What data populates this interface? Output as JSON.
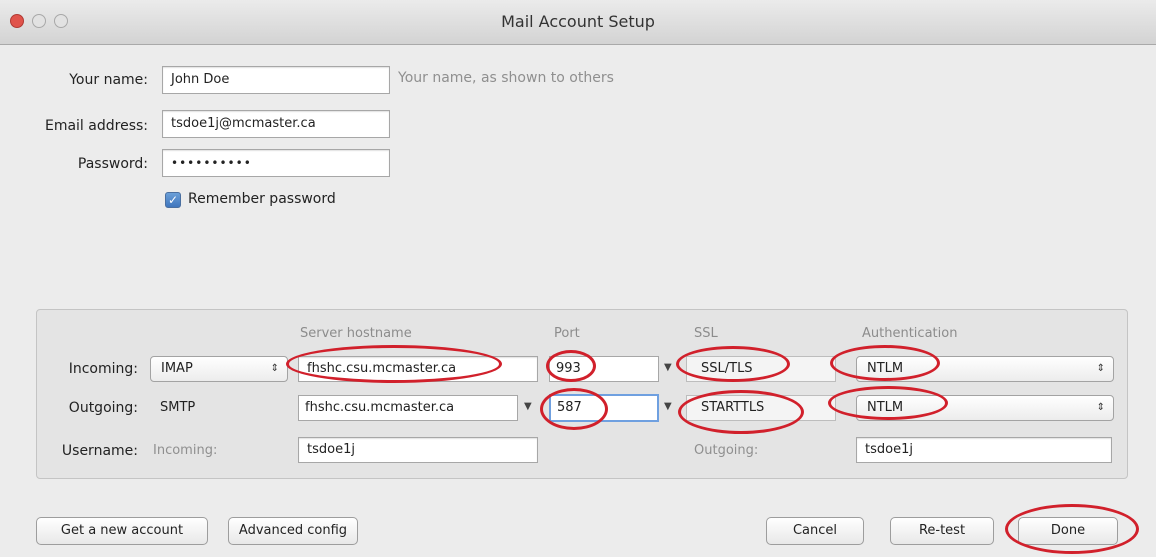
{
  "window": {
    "title": "Mail Account Setup"
  },
  "identity": {
    "name_label": "Your name:",
    "name_value": "John Doe",
    "name_hint": "Your name, as shown to others",
    "email_label": "Email address:",
    "email_value": "tsdoe1j@mcmaster.ca",
    "password_label": "Password:",
    "password_value": "••••••••••",
    "remember_label": "Remember password",
    "remember_checked": true
  },
  "server": {
    "headers": {
      "hostname": "Server hostname",
      "port": "Port",
      "ssl": "SSL",
      "auth": "Authentication"
    },
    "incoming": {
      "label": "Incoming:",
      "protocol": "IMAP",
      "hostname": "fhshc.csu.mcmaster.ca",
      "port": "993",
      "ssl": "SSL/TLS",
      "auth": "NTLM"
    },
    "outgoing": {
      "label": "Outgoing:",
      "protocol": "SMTP",
      "hostname": "fhshc.csu.mcmaster.ca",
      "port": "587",
      "ssl": "STARTTLS",
      "auth": "NTLM"
    },
    "username": {
      "label": "Username:",
      "incoming_label": "Incoming:",
      "incoming_value": "tsdoe1j",
      "outgoing_label": "Outgoing:",
      "outgoing_value": "tsdoe1j"
    }
  },
  "buttons": {
    "new_account": "Get a new account",
    "advanced": "Advanced config",
    "cancel": "Cancel",
    "retest": "Re-test",
    "done": "Done"
  },
  "colors": {
    "highlight_ring": "#d1202b",
    "focus": "#6fa0e0"
  },
  "icons": {
    "popup": "up-down-arrows-icon",
    "dropdown": "triangle-down-icon",
    "check": "checkmark-icon"
  }
}
